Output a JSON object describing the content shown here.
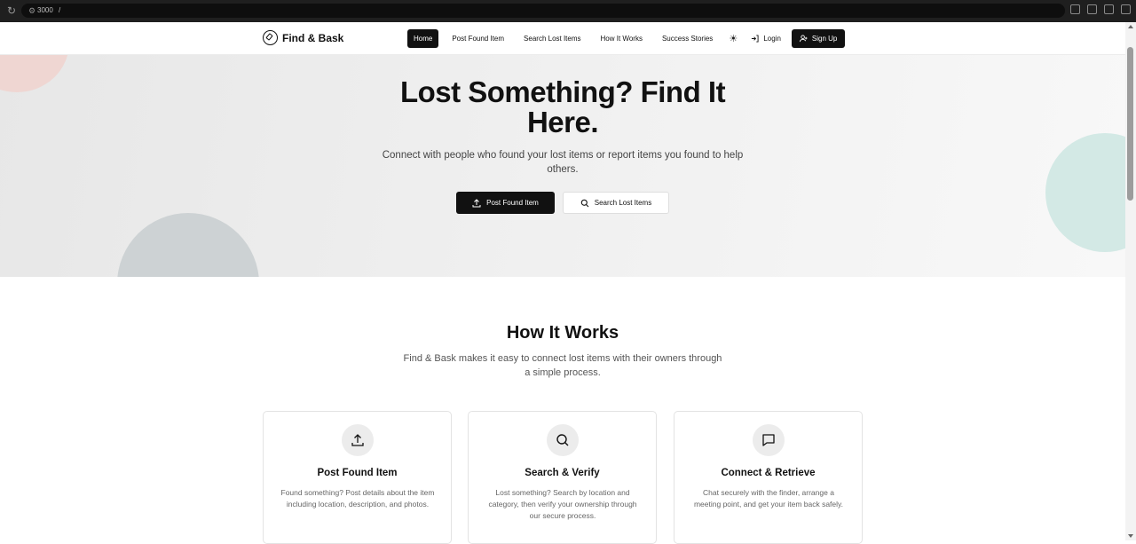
{
  "browser": {
    "url_host": "3000",
    "url_path": "/"
  },
  "nav": {
    "brand": "Find & Bask",
    "links": [
      "Home",
      "Post Found Item",
      "Search Lost Items",
      "How It Works",
      "Success Stories"
    ],
    "active_link": "Home",
    "login": "Login",
    "signup": "Sign Up"
  },
  "hero": {
    "title": "Lost Something? Find It Here.",
    "subtitle": "Connect with people who found your lost items or report items you found to help others.",
    "primary_button": "Post Found Item",
    "secondary_button": "Search Lost Items"
  },
  "how_it_works": {
    "title": "How It Works",
    "subtitle": "Find & Bask makes it easy to connect lost items with their owners through a simple process.",
    "cards": [
      {
        "icon": "upload-icon",
        "title": "Post Found Item",
        "description": "Found something? Post details about the item including location, description, and photos."
      },
      {
        "icon": "search-icon",
        "title": "Search & Verify",
        "description": "Lost something? Search by location and category, then verify your ownership through our secure process."
      },
      {
        "icon": "chat-icon",
        "title": "Connect & Retrieve",
        "description": "Chat securely with the finder, arrange a meeting point, and get your item back safely."
      }
    ]
  },
  "colors": {
    "primary": "#111111",
    "hero_background": "#ececec",
    "blob_pink": "#efd6d2",
    "blob_gray": "#cdd2d4",
    "blob_teal": "#d3e9e5"
  }
}
